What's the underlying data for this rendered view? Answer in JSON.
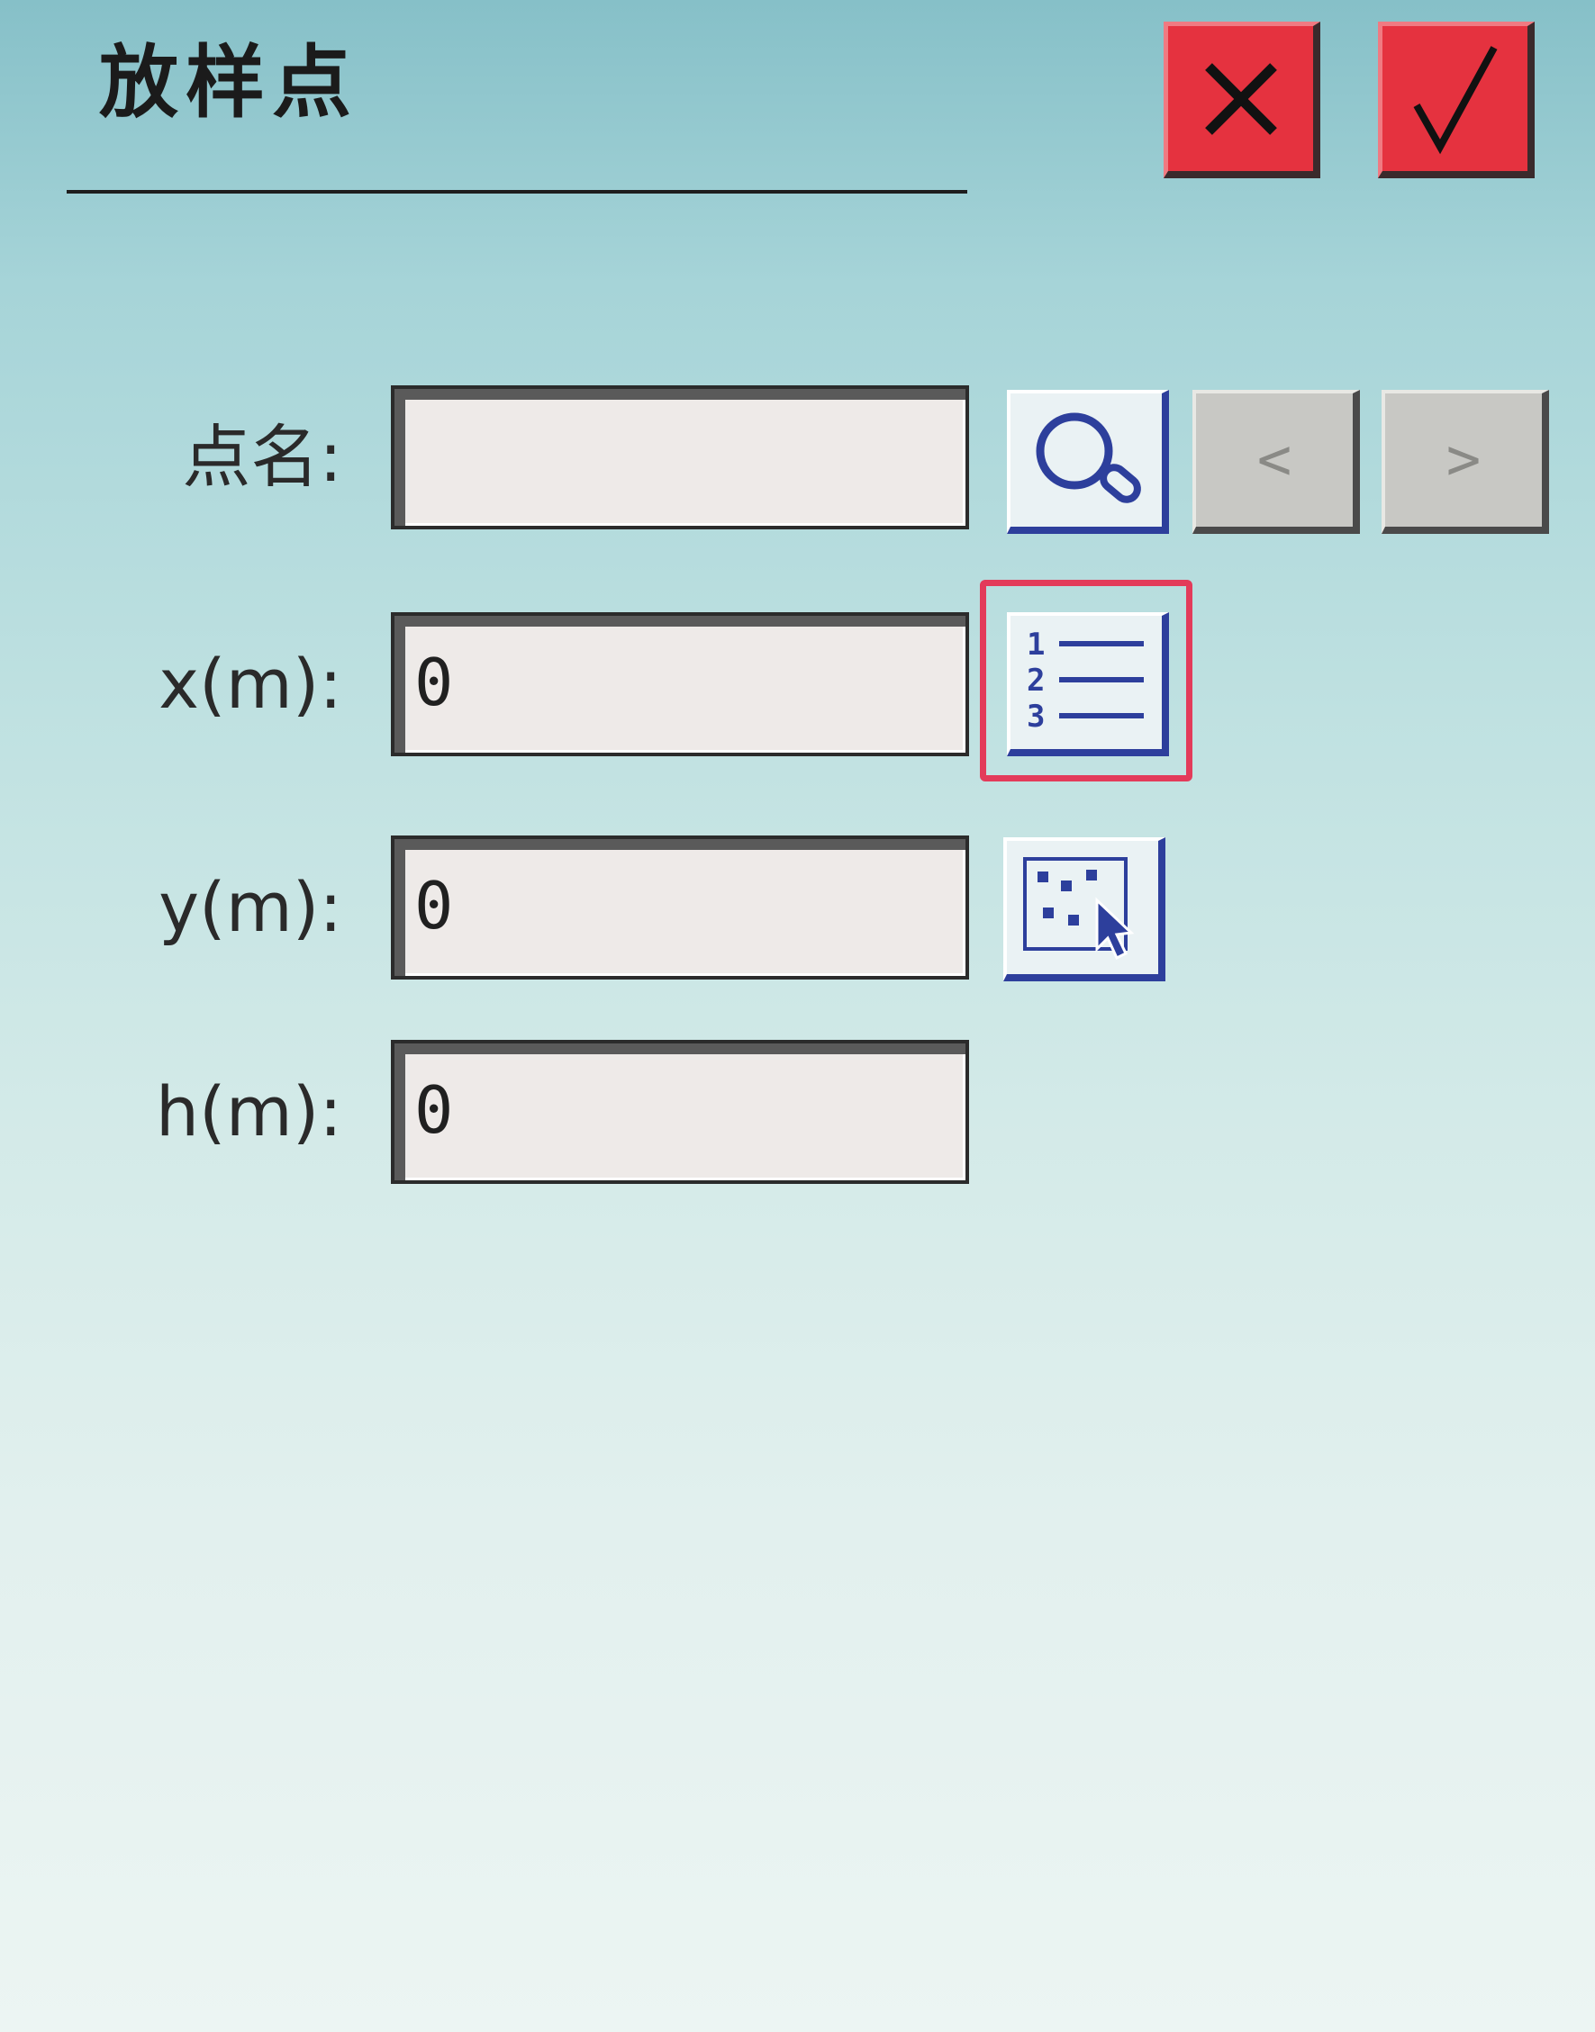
{
  "header": {
    "title": "放样点"
  },
  "actions": {
    "cancel_icon": "close-icon",
    "ok_icon": "checkmark-icon"
  },
  "form": {
    "point_name": {
      "label": "点名:",
      "value": ""
    },
    "x": {
      "label": "x(m):",
      "value": "0"
    },
    "y": {
      "label": "y(m):",
      "value": "0"
    },
    "h": {
      "label": "h(m):",
      "value": "0"
    }
  },
  "nav": {
    "prev_label": "<",
    "next_label": ">"
  },
  "tools": {
    "search_icon": "search-icon",
    "list_icon": "numbered-list-icon",
    "select_icon": "point-select-icon"
  },
  "colors": {
    "accent_red": "#e5323f",
    "button_blue": "#2d3f9c",
    "highlight": "#e33b5a"
  }
}
